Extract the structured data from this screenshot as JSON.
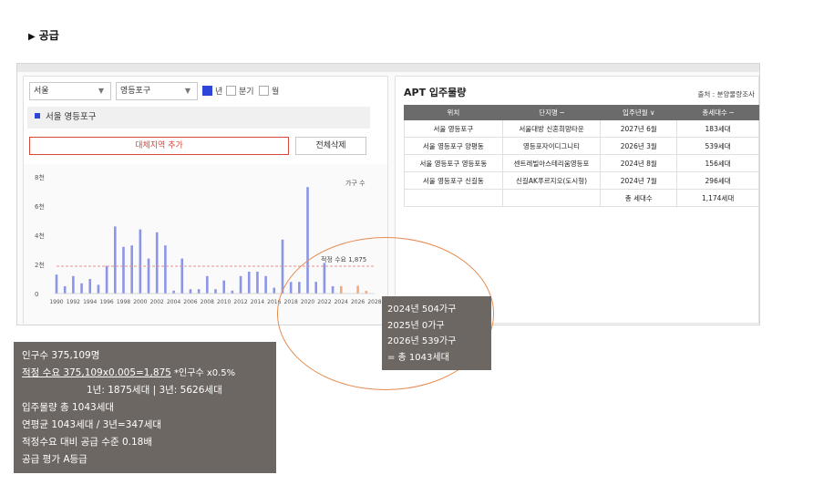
{
  "section": {
    "title": "공급",
    "marker": "▶"
  },
  "filters": {
    "city": "서울",
    "district": "영등포구",
    "period_options": [
      {
        "label": "년",
        "checked": true
      },
      {
        "label": "분기",
        "checked": false
      },
      {
        "label": "월",
        "checked": false
      }
    ]
  },
  "selected_region": "서울 영등포구",
  "buttons": {
    "add_compare": "대체지역 추가",
    "delete_all": "전체삭제"
  },
  "chart_data": {
    "type": "bar",
    "legend": "가구 수",
    "y_ticks": [
      "0",
      "2천",
      "4천",
      "6천",
      "8천"
    ],
    "ylim": [
      0,
      8000
    ],
    "x_ticks": [
      "1990",
      "1992",
      "1994",
      "1996",
      "1998",
      "2000",
      "2002",
      "2004",
      "2006",
      "2008",
      "2010",
      "2012",
      "2014",
      "2016",
      "2018",
      "2020",
      "2022",
      "2024",
      "2026",
      "2028"
    ],
    "years": [
      1990,
      1991,
      1992,
      1993,
      1994,
      1995,
      1996,
      1997,
      1998,
      1999,
      2000,
      2001,
      2002,
      2003,
      2004,
      2005,
      2006,
      2007,
      2008,
      2009,
      2010,
      2011,
      2012,
      2013,
      2014,
      2015,
      2016,
      2017,
      2018,
      2019,
      2020,
      2021,
      2022,
      2023,
      2024,
      2025,
      2026,
      2027,
      2028
    ],
    "values": [
      1300,
      500,
      1200,
      700,
      1000,
      600,
      1900,
      4600,
      3200,
      3300,
      4400,
      2400,
      4200,
      3300,
      200,
      2400,
      300,
      300,
      1200,
      300,
      900,
      200,
      1200,
      1500,
      1500,
      1200,
      400,
      3700,
      800,
      800,
      7300,
      800,
      2100,
      500,
      504,
      0,
      539,
      183,
      0
    ],
    "forecast_from": 2024,
    "colors": {
      "actual": "#8c96e8",
      "forecast": "#f3a883",
      "line": "#e8908f"
    },
    "reference": {
      "label": "적정 수요 1,875",
      "value": 1875
    }
  },
  "apt": {
    "title": "APT 입주물량",
    "source": "출처 : 분양물량조사",
    "columns": [
      "위치",
      "단지명 ─",
      "입주년월 ∨",
      "총세대수 ─"
    ],
    "rows": [
      [
        "서울 영등포구",
        "서울대방 신혼희망타운",
        "2027년 6월",
        "183세대"
      ],
      [
        "서울 영등포구 양평동",
        "영등포자이디그니티",
        "2026년 3월",
        "539세대"
      ],
      [
        "서울 영등포구 영등포동",
        "센트레빌아스테리움영등포",
        "2024년 8월",
        "156세대"
      ],
      [
        "서울 영등포구 신길동",
        "신길AK푸르지오(도시형)",
        "2024년 7월",
        "296세대"
      ],
      [
        "",
        "",
        "총 세대수",
        "1,174세대"
      ]
    ]
  },
  "info_left": {
    "population": "인구수    375,109명",
    "demand_formula": "적정 수요 375,109x0.005=1,875",
    "demand_note": " *인구수 x0.5%",
    "demand_yearly": "1년: 1875세대 | 3년: 5626세대",
    "supply_total": "입주물량 총 1043세대",
    "annual_avg": "연평균 1043세대 / 3년=347세대",
    "ratio": "적정수요 대비 공급 수준 0.18배",
    "grade": "공급 평가 A등급"
  },
  "info_right": {
    "l1": "2024년 504가구",
    "l2": "2025년 0가구",
    "l3": "2026년 539가구",
    "l4": "= 총 1043세대"
  }
}
